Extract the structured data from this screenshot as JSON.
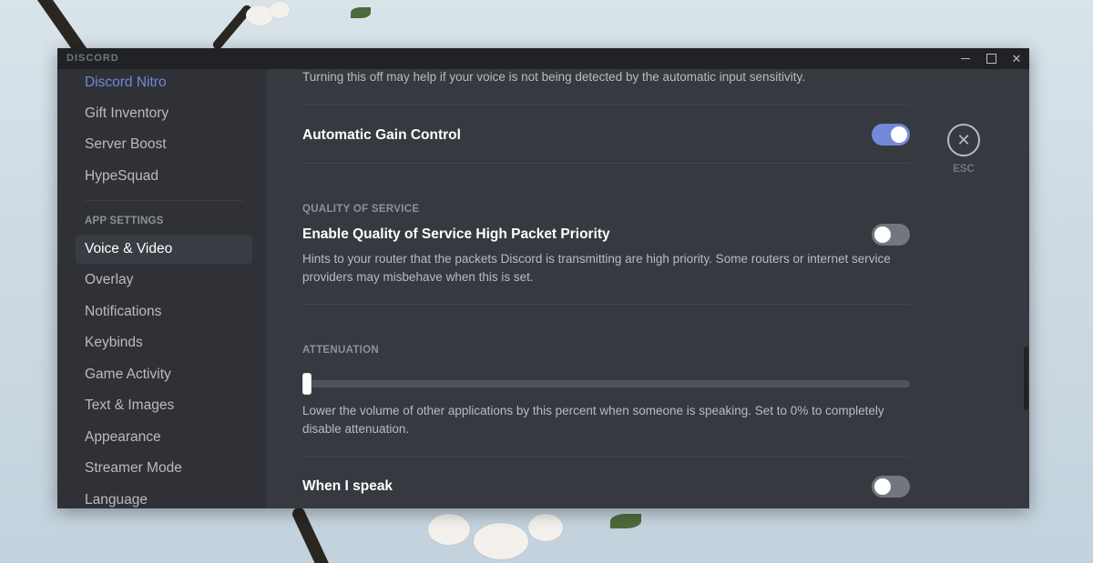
{
  "window": {
    "app_title": "DISCORD",
    "minimize_icon": "minimize-icon",
    "maximize_icon": "maximize-icon",
    "close_icon": "close-icon"
  },
  "sidebar": {
    "items_top": [
      {
        "label": "Discord Nitro"
      },
      {
        "label": "Gift Inventory"
      },
      {
        "label": "Server Boost"
      },
      {
        "label": "HypeSquad"
      }
    ],
    "app_settings_header": "APP SETTINGS",
    "items_app": [
      {
        "label": "Voice & Video",
        "selected": true
      },
      {
        "label": "Overlay"
      },
      {
        "label": "Notifications"
      },
      {
        "label": "Keybinds"
      },
      {
        "label": "Game Activity"
      },
      {
        "label": "Text & Images"
      },
      {
        "label": "Appearance"
      },
      {
        "label": "Streamer Mode"
      },
      {
        "label": "Language"
      }
    ]
  },
  "content": {
    "noise_desc": "Turning this off may help if your voice is not being detected by the automatic input sensitivity.",
    "agc": {
      "title": "Automatic Gain Control",
      "enabled": true
    },
    "qos": {
      "section_header": "QUALITY OF SERVICE",
      "title": "Enable Quality of Service High Packet Priority",
      "enabled": false,
      "description": "Hints to your router that the packets Discord is transmitting are high priority. Some routers or internet service providers may misbehave when this is set."
    },
    "attenuation": {
      "section_header": "ATTENUATION",
      "value_percent": 0,
      "description": "Lower the volume of other applications by this percent when someone is speaking. Set to 0% to completely disable attenuation."
    },
    "when_i_speak": {
      "title": "When I speak",
      "enabled": false
    }
  },
  "esc": {
    "icon": "close-icon",
    "label": "ESC"
  },
  "colors": {
    "accent": "#7289da",
    "background": "#36393f",
    "sidebar": "#2f3136",
    "titlebar": "#202225"
  }
}
